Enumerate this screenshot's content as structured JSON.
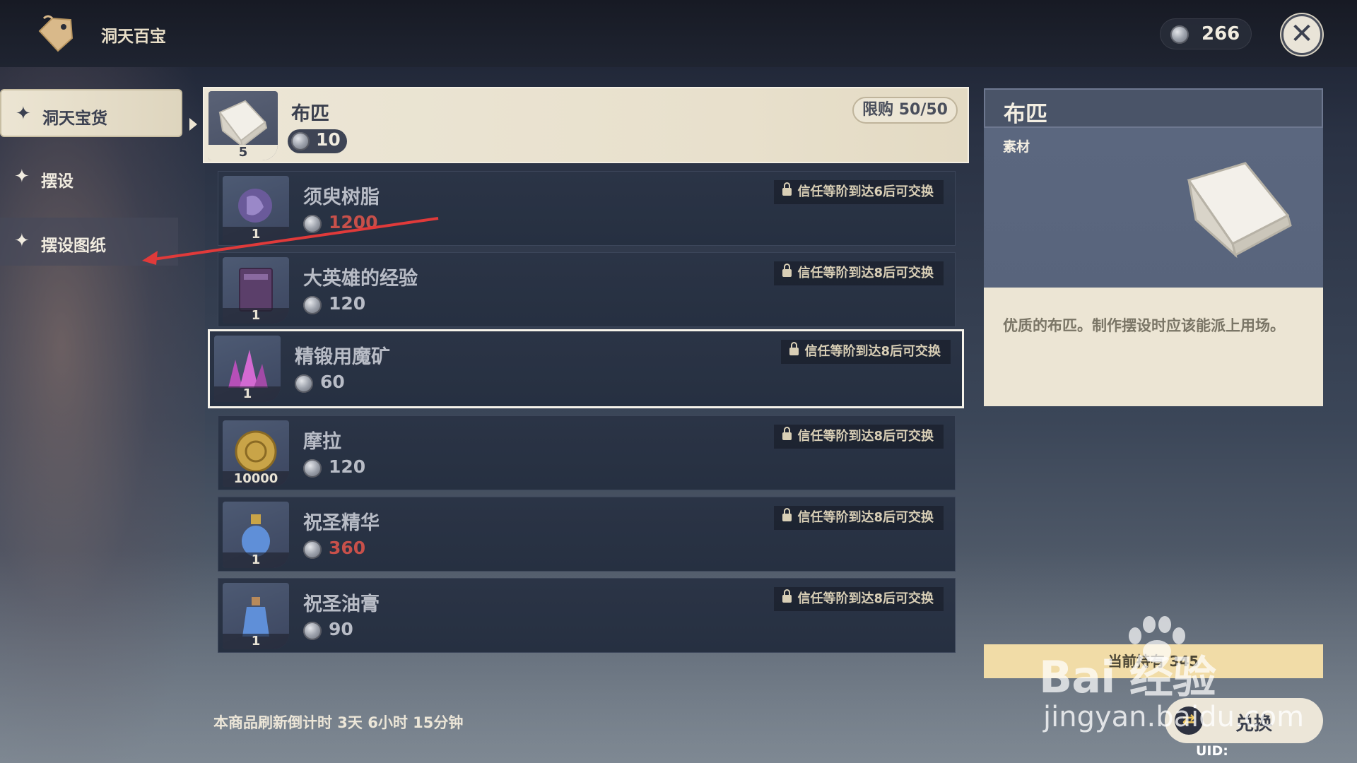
{
  "header": {
    "title": "洞天百宝",
    "currency_amount": "266"
  },
  "nav": {
    "items": [
      {
        "label": "洞天宝货",
        "active": true
      },
      {
        "label": "摆设",
        "active": false
      },
      {
        "label": "摆设图纸",
        "active": false
      }
    ]
  },
  "items": [
    {
      "name": "布匹",
      "qty": "5",
      "price": "10",
      "limit": "限购 50/50",
      "selected": true
    },
    {
      "name": "须臾树脂",
      "qty": "1",
      "price": "1200",
      "price_red": true,
      "lock": "信任等阶到达6后可交换"
    },
    {
      "name": "大英雄的经验",
      "qty": "1",
      "price": "120",
      "lock": "信任等阶到达8后可交换"
    },
    {
      "name": "精锻用魔矿",
      "qty": "1",
      "price": "60",
      "lock": "信任等阶到达8后可交换",
      "highlighted": true
    },
    {
      "name": "摩拉",
      "qty": "10000",
      "price": "120",
      "lock": "信任等阶到达8后可交换"
    },
    {
      "name": "祝圣精华",
      "qty": "1",
      "price": "360",
      "price_red": true,
      "lock": "信任等阶到达8后可交换"
    },
    {
      "name": "祝圣油膏",
      "qty": "1",
      "price": "90",
      "lock": "信任等阶到达8后可交换"
    }
  ],
  "detail": {
    "title": "布匹",
    "category": "素材",
    "description": "优质的布匹。制作摆设时应该能派上用场。"
  },
  "footer": {
    "refresh": "本商品刷新倒计时 3天 6小时 15分钟",
    "owned": "当前持有 345",
    "exchange_label": "兑换",
    "uid": "UID:"
  },
  "watermark": {
    "logo": "Bai 经验",
    "url": "jingyan.baidu.com"
  },
  "colors": {
    "accent_cream": "#ece6d6",
    "price_red": "#c8504a",
    "panel_blue": "#2b3446",
    "owned_bar": "#f1dca7"
  }
}
